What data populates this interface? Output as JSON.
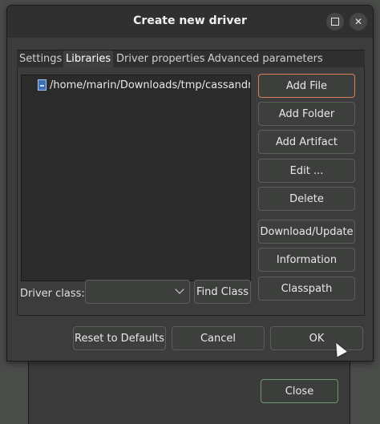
{
  "background_dialog": {
    "close_label": "Close"
  },
  "window": {
    "title": "Create new driver",
    "tabs": [
      {
        "label": "Settings",
        "active": false
      },
      {
        "label": "Libraries",
        "active": true
      },
      {
        "label": "Driver properties",
        "active": false
      },
      {
        "label": "Advanced parameters",
        "active": false
      }
    ]
  },
  "libraries": {
    "files": [
      {
        "path": "/home/marin/Downloads/tmp/cassandra",
        "icon": "jar-file-icon"
      }
    ],
    "buttons": {
      "add_file": "Add File",
      "add_folder": "Add Folder",
      "add_artifact": "Add Artifact",
      "edit": "Edit ...",
      "delete": "Delete",
      "download_update": "Download/Update",
      "information": "Information",
      "classpath": "Classpath"
    },
    "driver_class_label": "Driver class:",
    "driver_class_value": "",
    "find_class": "Find Class"
  },
  "footer": {
    "reset": "Reset to Defaults",
    "cancel": "Cancel",
    "ok": "OK"
  },
  "colors": {
    "focus_border": "#d9825a",
    "window_bg": "#3b3c3b",
    "titlebar_bg": "#2f302f"
  }
}
